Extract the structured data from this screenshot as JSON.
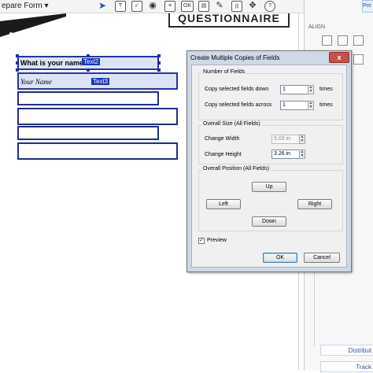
{
  "toolbar": {
    "title": "epare Form",
    "dropdown_glyph": "▾",
    "tools": [
      {
        "icon": "pointer-icon",
        "glyph": "➤"
      },
      {
        "icon": "text-field-icon",
        "glyph": "T"
      },
      {
        "icon": "checkbox-icon",
        "glyph": "✓"
      },
      {
        "icon": "radio-button-icon",
        "glyph": "◉"
      },
      {
        "icon": "list-box-icon",
        "glyph": "≡"
      },
      {
        "icon": "button-icon",
        "glyph": "OK"
      },
      {
        "icon": "dropdown-icon",
        "glyph": "▤"
      },
      {
        "icon": "signature-icon",
        "glyph": "✎"
      },
      {
        "icon": "barcode-icon",
        "glyph": "|||"
      },
      {
        "icon": "pin-icon",
        "glyph": "✥"
      },
      {
        "icon": "help-icon",
        "glyph": "?"
      }
    ]
  },
  "document": {
    "banner_text": "QUESTIONNAIRE",
    "fields": [
      {
        "label": "What is your name?",
        "tag": "Text2"
      },
      {
        "label": "Your Name",
        "tag": "Text3"
      }
    ]
  },
  "right_panel": {
    "pre_button": "Pre",
    "align_header": "ALIGN",
    "distribute_label": "Distribut",
    "track_label": "Track"
  },
  "dialog": {
    "title": "Create Multiple Copies of Fields",
    "close_glyph": "x",
    "number_of_fields": {
      "title": "Number of Fields",
      "copies_down_label": "Copy selected fields down",
      "copies_down_value": "1",
      "copies_across_label": "Copy selected fields across",
      "copies_across_value": "1",
      "times_label": "times"
    },
    "overall_size": {
      "title": "Overall Size (All Fields)",
      "width_label": "Change Width",
      "width_value": "5.03 in",
      "height_label": "Change Height",
      "height_value": "3.26 in"
    },
    "overall_position": {
      "title": "Overall Position (All Fields)",
      "up": "Up",
      "left": "Left",
      "right": "Right",
      "down": "Down"
    },
    "preview_label": "Preview",
    "preview_checked": true,
    "ok": "OK",
    "cancel": "Cancel"
  }
}
